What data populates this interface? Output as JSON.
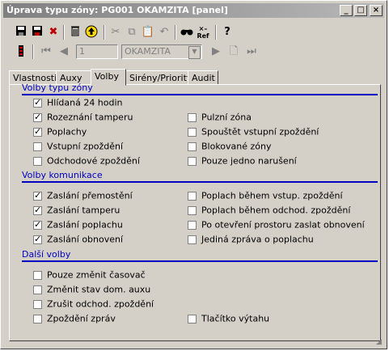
{
  "window": {
    "title": "Úprava typu zóny: PG001 OKAMZITA [panel]"
  },
  "titlebar_buttons": [
    "_",
    "□",
    "×"
  ],
  "navigator": {
    "record": "1",
    "selected": "OKAMZITA"
  },
  "tabs": [
    {
      "label": "Vlastnosti"
    },
    {
      "label": "Auxy"
    },
    {
      "label": "Volby"
    },
    {
      "label": "Sirény/Priority"
    },
    {
      "label": "Audit"
    }
  ],
  "sections": {
    "zone": {
      "title": "Volby typu zóny",
      "left": [
        {
          "label": "Hlídaná 24 hodin",
          "checked": true
        },
        {
          "label": "Rozeznání tamperu",
          "checked": true
        },
        {
          "label": "Poplachy",
          "checked": true
        },
        {
          "label": "Vstupní zpoždění",
          "checked": false
        },
        {
          "label": "Odchodové zpoždění",
          "checked": false
        }
      ],
      "right": [
        {
          "label": "Pulzní zóna",
          "checked": false
        },
        {
          "label": "Spouštět vstupní zpoždění",
          "checked": false
        },
        {
          "label": "Blokované zóny",
          "checked": false
        },
        {
          "label": "Pouze jedno narušení",
          "checked": false
        }
      ]
    },
    "comm": {
      "title": "Volby komunikace",
      "left": [
        {
          "label": "Zaslání přemostění",
          "checked": true
        },
        {
          "label": "Zaslání tamperu",
          "checked": true
        },
        {
          "label": "Zaslání poplachu",
          "checked": true
        },
        {
          "label": "Zaslání obnovení",
          "checked": true
        }
      ],
      "right": [
        {
          "label": "Poplach během vstup. zpoždění",
          "checked": false
        },
        {
          "label": "Poplach během odchod. zpoždění",
          "checked": false
        },
        {
          "label": "Po otevření prostoru zaslat obnovení",
          "checked": false
        },
        {
          "label": "Jediná zpráva o poplachu",
          "checked": false
        }
      ]
    },
    "other": {
      "title": "Další volby",
      "left": [
        {
          "label": "Pouze změnit časovač",
          "checked": false
        },
        {
          "label": "Změnit stav dom. auxu",
          "checked": false
        },
        {
          "label": "Zrušit odchod. zpoždění",
          "checked": false
        },
        {
          "label": "Zpoždění zpráv",
          "checked": false
        }
      ],
      "right": [
        {
          "label": "Tlačítko výtahu",
          "checked": false
        }
      ]
    }
  }
}
